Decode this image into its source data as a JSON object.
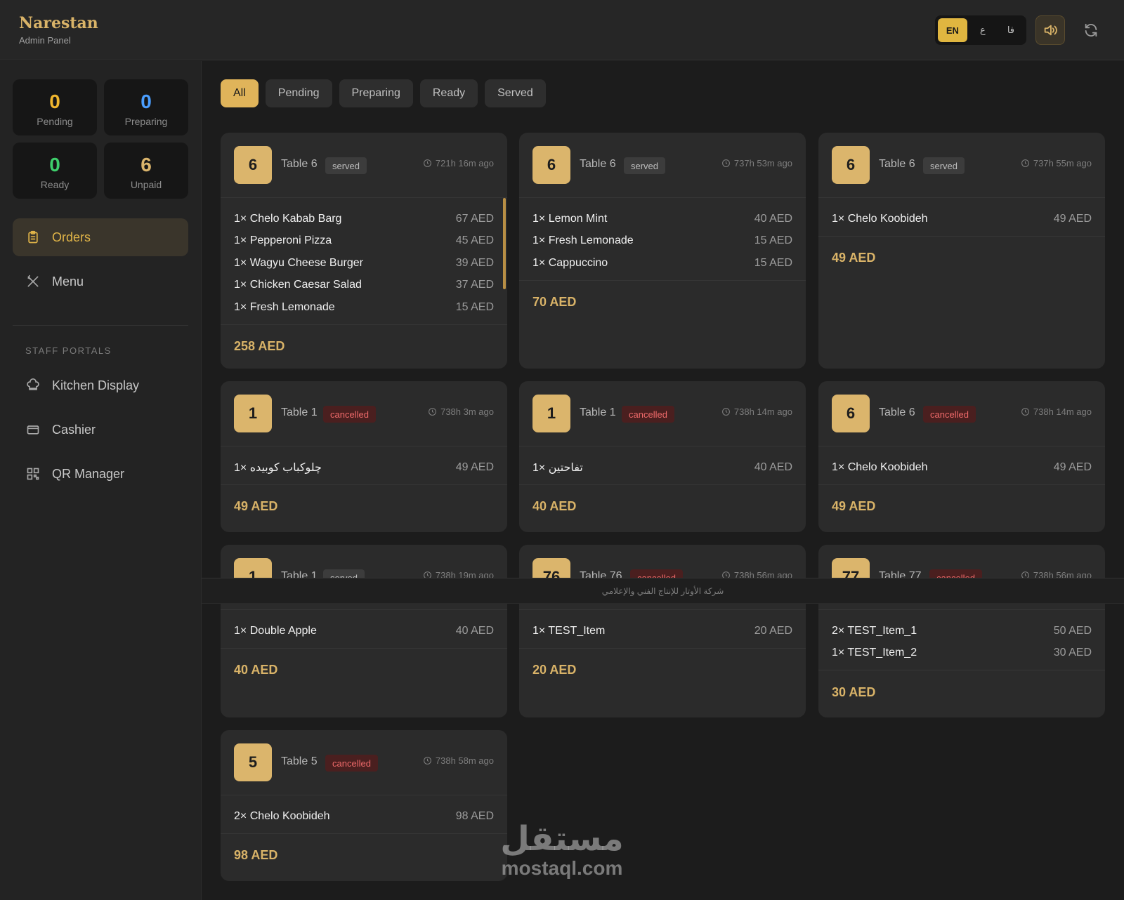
{
  "header": {
    "brand": "Narestan",
    "subtitle": "Admin Panel",
    "languages": [
      "EN",
      "ع",
      "فا"
    ],
    "active_language": "EN"
  },
  "colors": {
    "accent": "#e0b45a",
    "cancelled": "#ef6a6a",
    "ready": "#3ecf6b",
    "preparing": "#4a9eff"
  },
  "stats": [
    {
      "value": "0",
      "label": "Pending",
      "color": "#f0b62e"
    },
    {
      "value": "0",
      "label": "Preparing",
      "color": "#4a9eff"
    },
    {
      "value": "0",
      "label": "Ready",
      "color": "#3ecf6b"
    },
    {
      "value": "6",
      "label": "Unpaid",
      "color": "#dbb56c"
    }
  ],
  "nav": {
    "orders": "Orders",
    "menu": "Menu",
    "section_label": "STAFF PORTALS",
    "kitchen": "Kitchen Display",
    "cashier": "Cashier",
    "qr": "QR Manager"
  },
  "filters": [
    "All",
    "Pending",
    "Preparing",
    "Ready",
    "Served"
  ],
  "orders": [
    {
      "table_no": "6",
      "table": "Table 6",
      "status": "served",
      "age": "721h 16m ago",
      "items": [
        {
          "name": "1× Chelo Kabab Barg",
          "price": "67 AED"
        },
        {
          "name": "1× Pepperoni Pizza",
          "price": "45 AED"
        },
        {
          "name": "1× Wagyu Cheese Burger",
          "price": "39 AED"
        },
        {
          "name": "1× Chicken Caesar Salad",
          "price": "37 AED"
        },
        {
          "name": "1× Fresh Lemonade",
          "price": "15 AED"
        }
      ],
      "total": "258 AED"
    },
    {
      "table_no": "6",
      "table": "Table 6",
      "status": "served",
      "age": "737h 53m ago",
      "items": [
        {
          "name": "1× Lemon Mint",
          "price": "40 AED"
        },
        {
          "name": "1× Fresh Lemonade",
          "price": "15 AED"
        },
        {
          "name": "1× Cappuccino",
          "price": "15 AED"
        }
      ],
      "total": "70 AED"
    },
    {
      "table_no": "6",
      "table": "Table 6",
      "status": "served",
      "age": "737h 55m ago",
      "items": [
        {
          "name": "1× Chelo Koobideh",
          "price": "49 AED"
        }
      ],
      "total": "49 AED"
    },
    {
      "table_no": "1",
      "table": "Table 1",
      "status": "cancelled",
      "age": "738h 3m ago",
      "items": [
        {
          "name": "1× چلوکباب کوبیده",
          "price": "49 AED"
        }
      ],
      "total": "49 AED"
    },
    {
      "table_no": "1",
      "table": "Table 1",
      "status": "cancelled",
      "age": "738h 14m ago",
      "items": [
        {
          "name": "1× تفاحتين",
          "price": "40 AED"
        }
      ],
      "total": "40 AED"
    },
    {
      "table_no": "6",
      "table": "Table 6",
      "status": "cancelled",
      "age": "738h 14m ago",
      "items": [
        {
          "name": "1× Chelo Koobideh",
          "price": "49 AED"
        }
      ],
      "total": "49 AED"
    },
    {
      "table_no": "1",
      "table": "Table 1",
      "status": "served",
      "age": "738h 19m ago",
      "items": [
        {
          "name": "1× Double Apple",
          "price": "40 AED"
        }
      ],
      "total": "40 AED"
    },
    {
      "table_no": "76",
      "table": "Table 76",
      "status": "cancelled",
      "age": "738h 56m ago",
      "items": [
        {
          "name": "1× TEST_Item",
          "price": "20 AED"
        }
      ],
      "total": "20 AED"
    },
    {
      "table_no": "77",
      "table": "Table 77",
      "status": "cancelled",
      "age": "738h 56m ago",
      "items": [
        {
          "name": "2× TEST_Item_1",
          "price": "50 AED"
        },
        {
          "name": "1× TEST_Item_2",
          "price": "30 AED"
        }
      ],
      "total": "30 AED"
    },
    {
      "table_no": "5",
      "table": "Table 5",
      "status": "cancelled",
      "age": "738h 58m ago",
      "items": [
        {
          "name": "2× Chelo Koobideh",
          "price": "98 AED"
        }
      ],
      "total": "98 AED"
    }
  ],
  "overlay_text": "شركة الأوتار للإنتاج الفني والإعلامي",
  "watermark": {
    "arabic": "مستقل",
    "latin": "mostaql.com"
  }
}
